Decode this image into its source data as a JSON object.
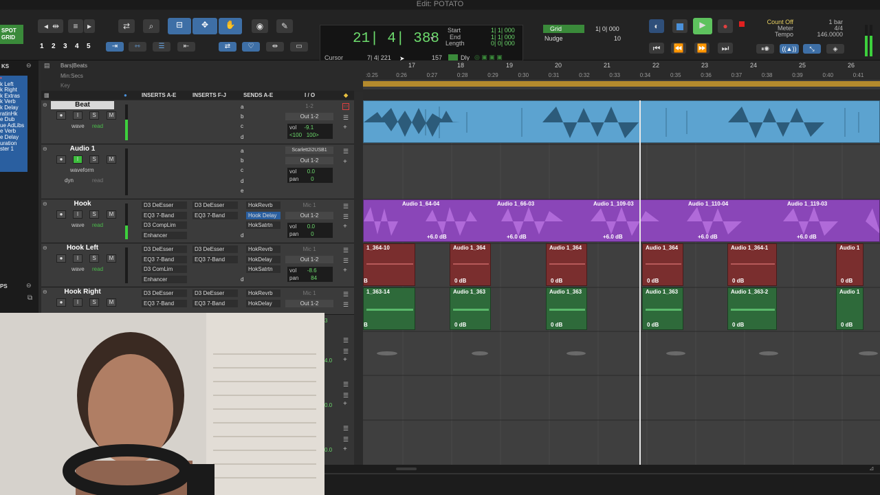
{
  "window": {
    "title": "Edit: POTATO"
  },
  "toolbar": {
    "mode_spot": "SPOT",
    "mode_grid": "GRID",
    "zoom_presets": [
      "1",
      "2",
      "3",
      "4",
      "5"
    ],
    "main_counter": "21| 4| 388",
    "start_label": "Start",
    "end_label": "End",
    "length_label": "Length",
    "start_value": "1| 1| 000",
    "end_value": "1| 1| 000",
    "length_value": "0| 0| 000",
    "cursor_label": "Cursor",
    "cursor_value": "7| 4| 221",
    "sample_value": "157",
    "dly_label": "Dly",
    "grid_label": "Grid",
    "grid_value": "1| 0| 000",
    "nudge_label": "Nudge",
    "nudge_value": "10",
    "count_off": "Count Off",
    "meter_label": "Meter",
    "tempo_label": "Tempo",
    "count_value": "1 bar",
    "meter_value": "4/4",
    "tempo_value": "146.0000"
  },
  "left_panel": {
    "items": [
      "KS",
      "k Left",
      "k Right",
      "k Extras",
      "k Verb",
      "k Delay",
      "ratinHk",
      "e Dub",
      "ue AdLibs",
      "e Verb",
      "e Delay",
      "uration",
      "ster 1"
    ],
    "bottom_label": "PS"
  },
  "rulers": {
    "bars_beats": "Bars|Beats",
    "min_secs": "Min:Secs",
    "key": "Key",
    "bar_numbers": [
      "17",
      "18",
      "19",
      "20",
      "21",
      "22",
      "23",
      "24",
      "25",
      "26"
    ],
    "time_ticks": [
      ":0.25",
      "0:26",
      "0:27",
      "0:28",
      "0:29",
      "0:30",
      "0:31",
      "0:32",
      "0:33",
      "0:34",
      "0:35",
      "0:36",
      "0:37",
      "0:38",
      "0:39",
      "0:40",
      "0:41"
    ]
  },
  "columns": {
    "inserts_ae": "INSERTS A-E",
    "inserts_fj": "INSERTS F-J",
    "sends_ae": "SENDS A-E",
    "io": "I / O"
  },
  "tracks": [
    {
      "name": "Beat",
      "view": "wave",
      "automation": "read",
      "inserts": [
        "",
        "",
        "",
        ""
      ],
      "inserts2": [
        "",
        "",
        "",
        ""
      ],
      "sends": [
        "a",
        "b",
        "c",
        "d"
      ],
      "input": "1-2",
      "output": "Out 1-2",
      "vol": "-9.1",
      "pan_l": "<100",
      "pan_r": "100>"
    },
    {
      "name": "Audio 1",
      "view": "waveform",
      "automation": "read",
      "extra": "dyn",
      "inserts": [
        "",
        "",
        "",
        ""
      ],
      "inserts2": [
        "",
        "",
        "",
        ""
      ],
      "sends": [
        "a",
        "b",
        "c",
        "d",
        "e"
      ],
      "input": "Scarlett2i2USB1",
      "output": "Out 1-2",
      "vol": "0.0",
      "pan": "0"
    },
    {
      "name": "Hook",
      "view": "wave",
      "automation": "read",
      "inserts": [
        "D3 DeEsser",
        "EQ3 7-Band",
        "D3 CompLim",
        "Enhancer"
      ],
      "inserts2": [
        "D3 DeEsser",
        "EQ3 7-Band",
        "",
        ""
      ],
      "sends": [
        "HokRevrb",
        "Hook Delay",
        "HokSatrtn",
        "d"
      ],
      "input": "Mic 1",
      "output": "Out 1-2",
      "vol": "0.0",
      "pan": "0"
    },
    {
      "name": "Hook Left",
      "view": "wave",
      "automation": "read",
      "inserts": [
        "D3 DeEsser",
        "EQ3 7-Band",
        "D3 ComLim",
        "Enhancer"
      ],
      "inserts2": [
        "D3 DeEsser",
        "EQ3 7-Band",
        "",
        ""
      ],
      "sends": [
        "HokRevrb",
        "HokDelay",
        "HokSatrtn",
        "d"
      ],
      "input": "Mic 1",
      "output": "Out 1-2",
      "vol": "-8.6",
      "pan": "84"
    },
    {
      "name": "Hook Right",
      "view": "wave",
      "automation": "read",
      "inserts": [
        "D3 DeEsser",
        "EQ3 7-Band",
        "",
        ""
      ],
      "inserts2": [
        "D3 DeEsser",
        "EQ3 7-Band",
        "",
        ""
      ],
      "sends": [
        "HokRevrb",
        "HokDelay",
        "",
        ""
      ],
      "input": "Mic 1",
      "output": "Out 1-2",
      "vol": "",
      "pan": ""
    }
  ],
  "hidden_track_values": [
    "3",
    "4.0",
    "0.0",
    "0.0"
  ],
  "clips": {
    "hook": [
      {
        "name": "Audio 1_64-04",
        "gain": "+6.0 dB"
      },
      {
        "name": "Audio 1_66-03",
        "gain": "+6.0 dB"
      },
      {
        "name": "Audio 1_109-03",
        "gain": "+6.0 dB"
      },
      {
        "name": "Audio 1_110-04",
        "gain": "+6.0 dB"
      },
      {
        "name": "Audio 1_119-03",
        "gain": "+6.0 dB"
      }
    ],
    "hook_left": [
      {
        "name": "1_364-10",
        "gain": "B"
      },
      {
        "name": "Audio 1_364",
        "gain": "0 dB"
      },
      {
        "name": "Audio 1_364",
        "gain": "0 dB"
      },
      {
        "name": "Audio 1_364",
        "gain": "0 dB"
      },
      {
        "name": "Audio 1_364-1",
        "gain": "0 dB"
      },
      {
        "name": "Audio 1",
        "gain": "0 dB"
      }
    ],
    "hook_right": [
      {
        "name": "1_363-14",
        "gain": "B"
      },
      {
        "name": "Audio 1_363",
        "gain": "0 dB"
      },
      {
        "name": "Audio 1_363",
        "gain": "0 dB"
      },
      {
        "name": "Audio 1_363",
        "gain": "0 dB"
      },
      {
        "name": "Audio 1_363-2",
        "gain": "0 dB"
      },
      {
        "name": "Audio 1",
        "gain": "0 dB"
      }
    ]
  },
  "colors": {
    "beat_clip": "#5ca3d0",
    "hook_clip": "#8a46b8",
    "hook_left_clip": "#7a2e2e",
    "hook_right_clip": "#2e6a3a",
    "tempo_bar": "#b48a2d"
  }
}
